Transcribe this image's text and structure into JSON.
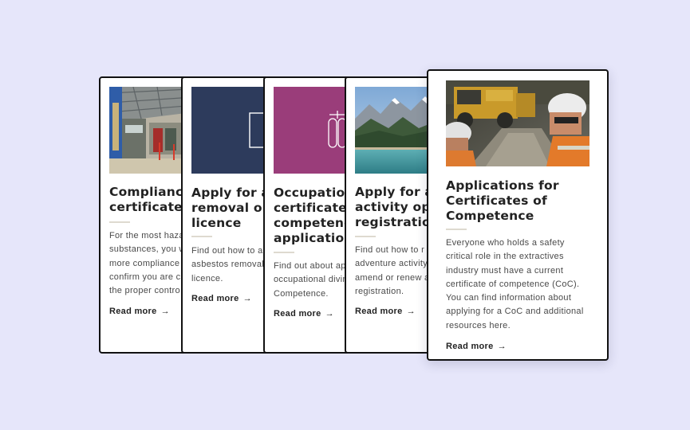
{
  "cards": [
    {
      "title": "Compliance\ncertificates",
      "description": "For the most haza\nsubstances, you w\nmore compliance \nconfirm you are c\nthe proper contro",
      "read_more": "Read more",
      "image": "warehouse-interior"
    },
    {
      "title": "Apply for a\nremoval or\nlicence",
      "description": "Find out how to a\nasbestos removal\nlicence.",
      "read_more": "Read more",
      "image": "navy-licence-icon"
    },
    {
      "title": "Occupation\ncertificate c\ncompetenc\napplication",
      "description": "Find out about ap\noccupational divin\nCompetence.",
      "read_more": "Read more",
      "image": "purple-diving-icon"
    },
    {
      "title": "Apply for a\nactivity ope\nregistration",
      "description": "Find out how to r\nadventure activity\namend or renew a\nregistration.",
      "read_more": "Read more",
      "image": "mountain-lake"
    },
    {
      "title": "Applications for\nCertificates of\nCompetence",
      "description": "Everyone who holds a safety\ncritical role in the extractives\nindustry must have a current\ncertificate of competence (CoC).\nYou can find information about\napplying for a CoC and additional\nresources here.",
      "read_more": "Read more",
      "image": "mining-workers"
    }
  ],
  "arrow_glyph": "→",
  "colors": {
    "background": "#e6e6fa",
    "navy": "#2d3b5c",
    "purple": "#9a3d7a",
    "rule": "#dedad0"
  }
}
